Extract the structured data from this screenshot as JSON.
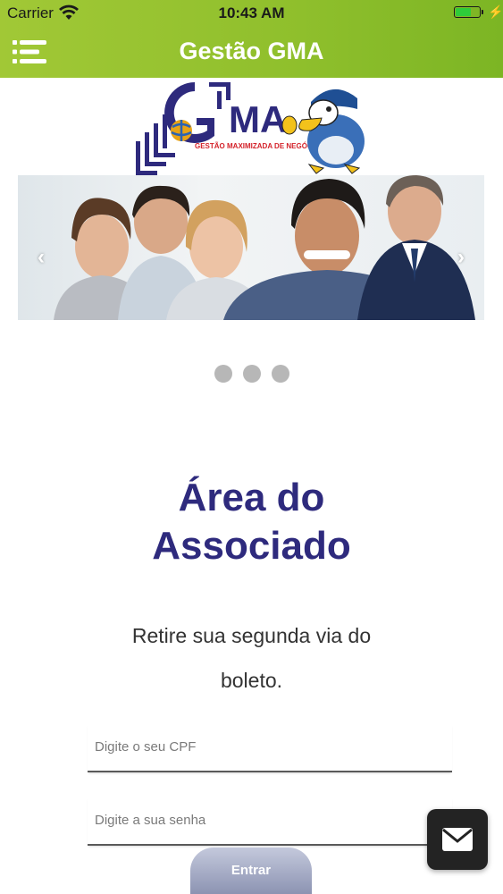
{
  "status_bar": {
    "carrier": "Carrier",
    "time": "10:43 AM",
    "battery_color": "#2ecc3a"
  },
  "nav": {
    "title": "Gestão GMA",
    "menu_icon": "menu-icon",
    "bar_color": "#8fbf2c"
  },
  "logo": {
    "letters": "GMA",
    "tagline": "GESTÃO MAXIMIZADA DE NEGÓCIOS",
    "mascot_icon": "eagle-mascot-icon"
  },
  "carousel": {
    "prev_glyph": "‹",
    "next_glyph": "›",
    "dots_count": 3
  },
  "main": {
    "heading_line1": "Área do",
    "heading_line2": "Associado",
    "subtitle_line1": "Retire sua segunda via do",
    "subtitle_line2": "boleto.",
    "cpf_placeholder": "Digite o seu CPF",
    "senha_placeholder": "Digite a sua senha",
    "submit_label": "Entrar",
    "heading_color": "#2e2a7d"
  },
  "fab": {
    "icon": "mail-icon"
  }
}
